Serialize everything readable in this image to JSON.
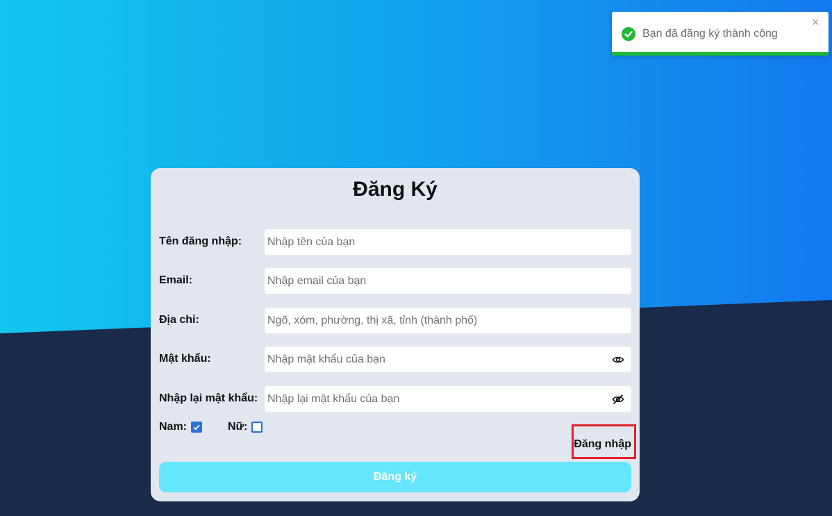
{
  "toast": {
    "message": "Bạn đã đăng ký thành công",
    "close_glyph": "×",
    "progress": 1.0,
    "color": "#1fb834"
  },
  "form": {
    "title": "Đăng Ký",
    "fields": [
      {
        "label": "Tên đăng nhập:",
        "placeholder": "Nhập tên của bạn",
        "value": ""
      },
      {
        "label": "Email:",
        "placeholder": "Nhập email của bạn",
        "value": ""
      },
      {
        "label": "Địa chỉ:",
        "placeholder": "Ngõ, xóm, phường, thị xã, tỉnh (thành phố)",
        "value": ""
      },
      {
        "label": "Mật khẩu:",
        "placeholder": "Nhập mật khẩu của bạn",
        "value": "",
        "icon": "eye-icon"
      },
      {
        "label": "Nhập lại mật khẩu:",
        "placeholder": "Nhập lại mật khẩu của bạn",
        "value": "",
        "icon": "eye-off-icon"
      }
    ],
    "gender": {
      "male_label": "Nam:",
      "male_checked": true,
      "female_label": "Nữ:",
      "female_checked": false
    },
    "login_link": "Đăng nhập",
    "submit_label": "Đăng ký"
  },
  "colors": {
    "gradient_start": "#13c6ee",
    "gradient_end": "#1478f0",
    "bottom_bg": "#1a2a4a",
    "card_bg": "#e1e6ef",
    "submit_bg": "#66e6fa",
    "highlight_border": "#e0212c",
    "checkbox": "#2a6fdb"
  }
}
